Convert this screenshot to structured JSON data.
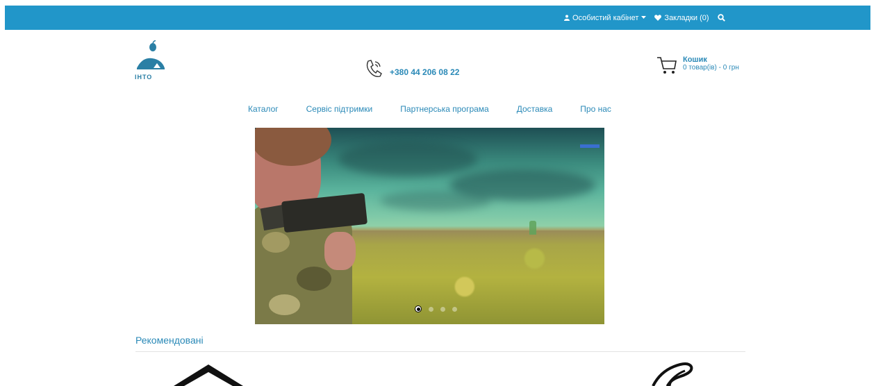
{
  "topbar": {
    "account_label": "Особистий кабінет",
    "bookmarks_label": "Закладки (0)"
  },
  "header": {
    "logo_text": "ІНТО",
    "phone": "+380 44 206 08 22",
    "cart_title": "Кошик",
    "cart_summary": "0 товар(ів) - 0 грн"
  },
  "nav": {
    "items": [
      "Каталог",
      "Сервіс підтримки",
      "Партнерська програма",
      "Доставка",
      "Про нас"
    ]
  },
  "slider": {
    "active_index": 0,
    "total": 4
  },
  "recommended": {
    "title": "Рекомендовані"
  },
  "colors": {
    "accent": "#2196c9",
    "link": "#2a89b7"
  }
}
